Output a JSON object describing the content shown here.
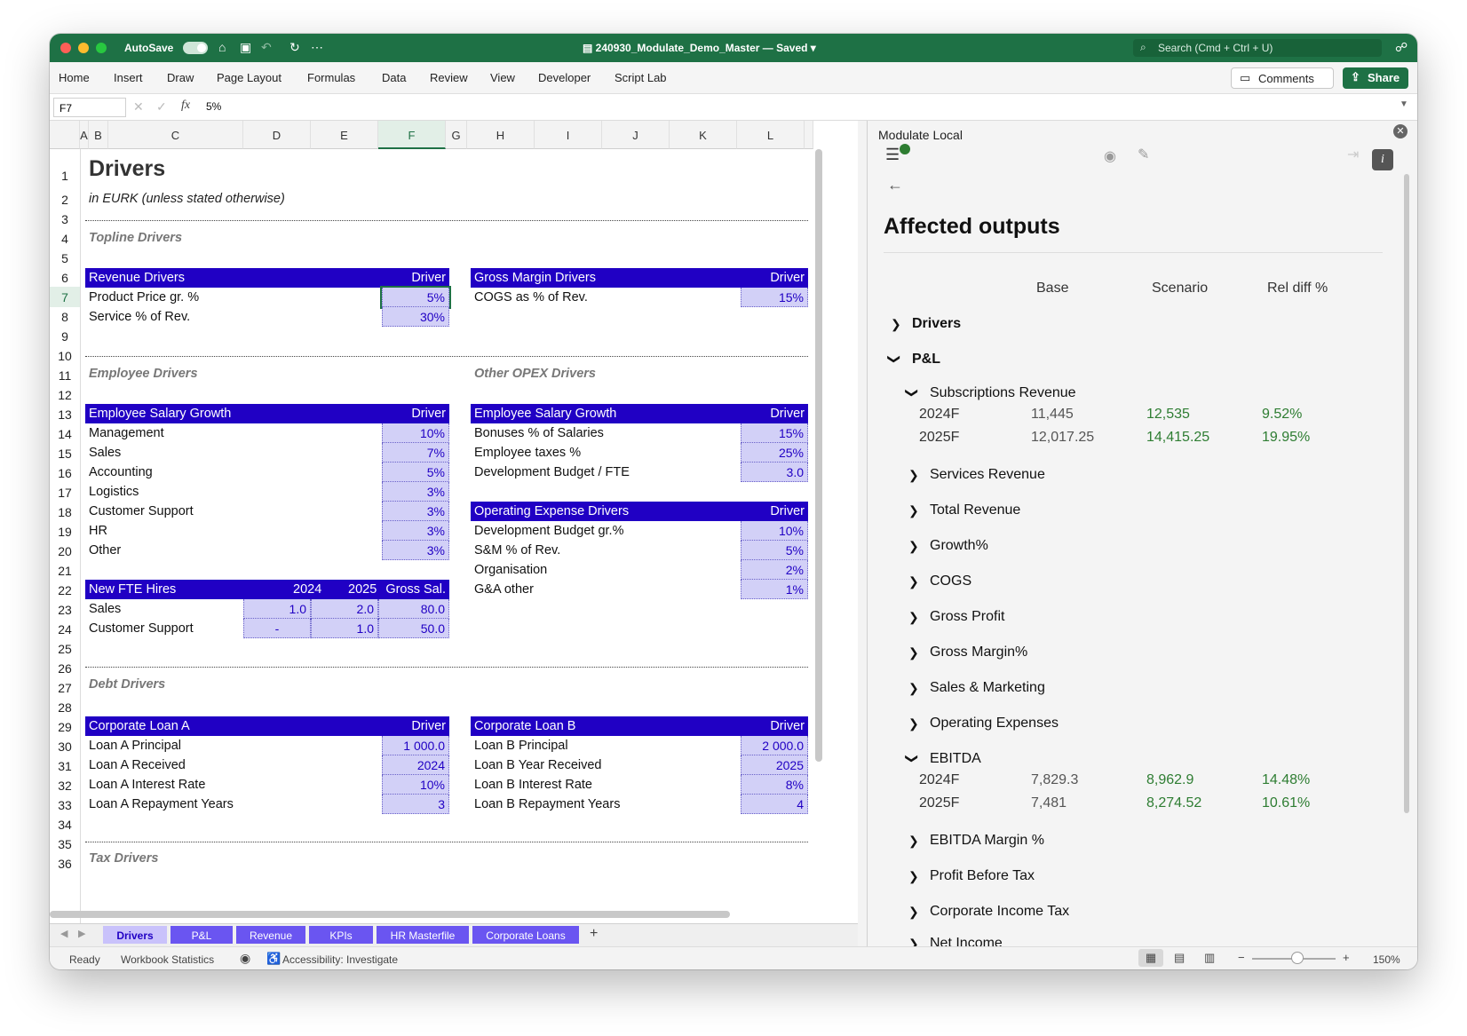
{
  "titlebar": {
    "autosave_label": "AutoSave",
    "doc_title": "240930_Modulate_Demo_Master — Saved",
    "search_placeholder": "Search (Cmd + Ctrl + U)"
  },
  "ribbon": {
    "tabs": [
      "Home",
      "Insert",
      "Draw",
      "Page Layout",
      "Formulas",
      "Data",
      "Review",
      "View",
      "Developer",
      "Script Lab"
    ],
    "comments_label": "Comments",
    "share_label": "Share"
  },
  "formula_bar": {
    "cell_ref": "F7",
    "fx": "fx",
    "value": "5%"
  },
  "sheet": {
    "columns": [
      "A",
      "B",
      "C",
      "D",
      "E",
      "F",
      "G",
      "H",
      "I",
      "J",
      "K",
      "L"
    ],
    "rows": [
      "1",
      "2",
      "3",
      "4",
      "5",
      "6",
      "7",
      "8",
      "9",
      "10",
      "11",
      "12",
      "13",
      "14",
      "15",
      "16",
      "17",
      "18",
      "19",
      "20",
      "21",
      "22",
      "23",
      "24",
      "25",
      "26",
      "27",
      "28",
      "29",
      "30",
      "31",
      "32",
      "33",
      "34",
      "35",
      "36"
    ],
    "title": "Drivers",
    "subtitle": "in EURK (unless stated otherwise)",
    "sections": {
      "topline": "Topline Drivers",
      "employee": "Employee Drivers",
      "other_opex": "Other OPEX Drivers",
      "debt": "Debt Drivers",
      "tax": "Tax Drivers"
    },
    "driver_label": "Driver",
    "revenue": {
      "header": "Revenue Drivers",
      "rows": [
        {
          "label": "Product Price gr. %",
          "value": "5%"
        },
        {
          "label": "Service % of Rev.",
          "value": "30%"
        }
      ]
    },
    "gross_margin": {
      "header": "Gross Margin Drivers",
      "rows": [
        {
          "label": "COGS as % of Rev.",
          "value": "15%"
        }
      ]
    },
    "salary_growth": {
      "header": "Employee Salary Growth",
      "rows": [
        {
          "label": "Management",
          "value": "10%"
        },
        {
          "label": "Sales",
          "value": "7%"
        },
        {
          "label": "Accounting",
          "value": "5%"
        },
        {
          "label": "Logistics",
          "value": "3%"
        },
        {
          "label": "Customer Support",
          "value": "3%"
        },
        {
          "label": "HR",
          "value": "3%"
        },
        {
          "label": "Other",
          "value": "3%"
        }
      ]
    },
    "other_salary": {
      "header": "Employee Salary Growth",
      "rows": [
        {
          "label": "Bonuses % of Salaries",
          "value": "15%"
        },
        {
          "label": "Employee taxes %",
          "value": "25%"
        },
        {
          "label": "Development Budget / FTE",
          "value": "3.0"
        }
      ]
    },
    "opex": {
      "header": "Operating Expense Drivers",
      "rows": [
        {
          "label": "Development Budget gr.%",
          "value": "10%"
        },
        {
          "label": "S&M % of Rev.",
          "value": "5%"
        },
        {
          "label": "Organisation",
          "value": "2%"
        },
        {
          "label": "G&A other",
          "value": "1%"
        }
      ]
    },
    "fte": {
      "header": "New FTE Hires",
      "col2024": "2024",
      "col2025": "2025",
      "colsal": "Gross Sal.",
      "rows": [
        {
          "label": "Sales",
          "v2024": "1.0",
          "v2025": "2.0",
          "sal": "80.0"
        },
        {
          "label": "Customer Support",
          "v2024": "-",
          "v2025": "1.0",
          "sal": "50.0"
        }
      ]
    },
    "loan_a": {
      "header": "Corporate Loan A",
      "rows": [
        {
          "label": "Loan A Principal",
          "value": "1 000.0"
        },
        {
          "label": "Loan A Received",
          "value": "2024"
        },
        {
          "label": "Loan A Interest Rate",
          "value": "10%"
        },
        {
          "label": "Loan A Repayment Years",
          "value": "3"
        }
      ]
    },
    "loan_b": {
      "header": "Corporate Loan B",
      "rows": [
        {
          "label": "Loan B Principal",
          "value": "2 000.0"
        },
        {
          "label": "Loan B Year Received",
          "value": "2025"
        },
        {
          "label": "Loan B Interest Rate",
          "value": "8%"
        },
        {
          "label": "Loan B Repayment Years",
          "value": "4"
        }
      ]
    }
  },
  "sheet_tabs": [
    "Drivers",
    "P&L",
    "Revenue",
    "KPIs",
    "HR Masterfile",
    "Corporate Loans"
  ],
  "status": {
    "ready": "Ready",
    "stats": "Workbook Statistics",
    "accessibility": "Accessibility: Investigate",
    "zoom": "150%"
  },
  "panel": {
    "title": "Modulate Local",
    "heading": "Affected outputs",
    "columns": {
      "base": "Base",
      "scenario": "Scenario",
      "rel": "Rel diff %"
    },
    "groups": {
      "drivers": "Drivers",
      "pl": "P&L",
      "subscriptions": "Subscriptions Revenue",
      "sub_rows": [
        {
          "year": "2024F",
          "base": "11,445",
          "scenario": "12,535",
          "rel": "9.52%"
        },
        {
          "year": "2025F",
          "base": "12,017.25",
          "scenario": "14,415.25",
          "rel": "19.95%"
        }
      ],
      "collapsed_a": [
        "Services Revenue",
        "Total Revenue",
        "Growth%",
        "COGS",
        "Gross Profit",
        "Gross Margin%",
        "Sales & Marketing",
        "Operating Expenses"
      ],
      "ebitda": "EBITDA",
      "ebitda_rows": [
        {
          "year": "2024F",
          "base": "7,829.3",
          "scenario": "8,962.9",
          "rel": "14.48%"
        },
        {
          "year": "2025F",
          "base": "7,481",
          "scenario": "8,274.52",
          "rel": "10.61%"
        }
      ],
      "collapsed_b": [
        "EBITDA Margin %",
        "Profit Before Tax",
        "Corporate Income Tax",
        "Net Income"
      ]
    }
  },
  "colors": {
    "excel_green": "#1e7145",
    "header_blue": "#2000c4",
    "driver_fill": "#d2d0f7",
    "tab_purple": "#6a55f1",
    "positive_green": "#2e7d32"
  }
}
